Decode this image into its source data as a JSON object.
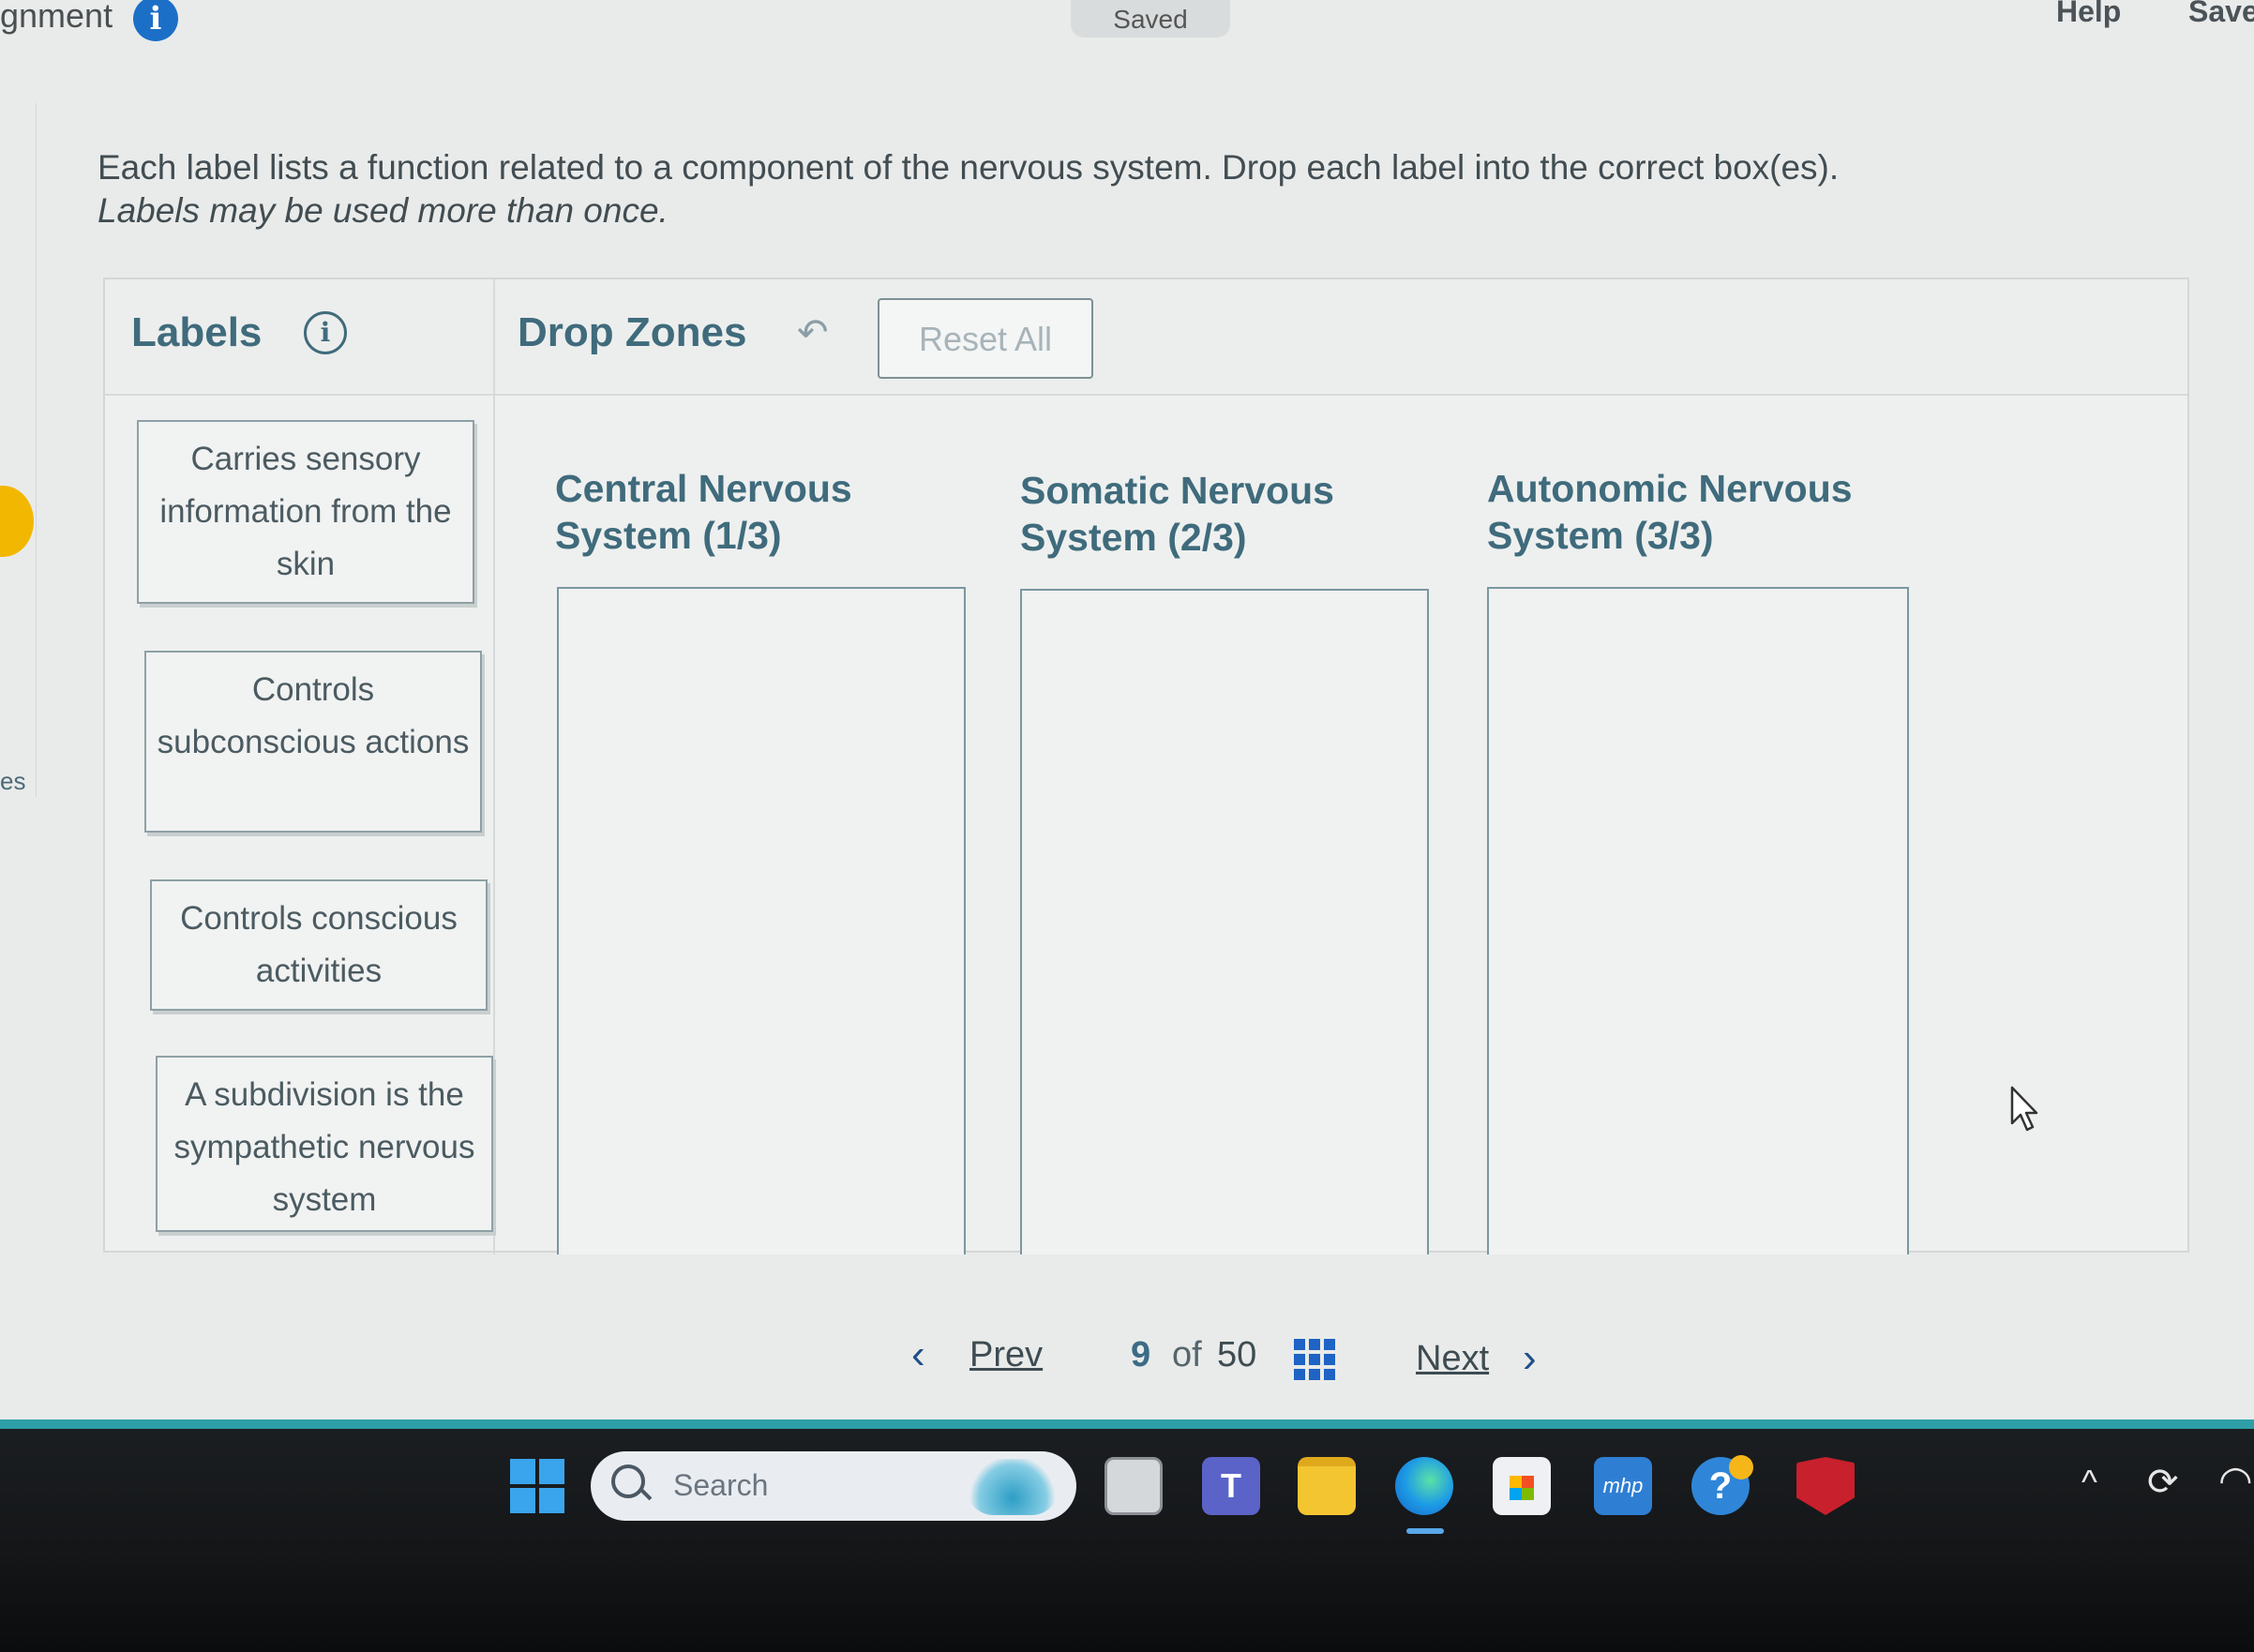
{
  "topbar": {
    "assignment_title_fragment": "gnment",
    "info_glyph": "i",
    "saved_status": "Saved",
    "help_label": "Help",
    "save_label": "Save"
  },
  "side": {
    "tab_fragment": "es"
  },
  "instructions": {
    "line1": "Each label lists a function related to a component of the nervous system. Drop each label into the correct box(es).",
    "line2": "Labels may be used more than once."
  },
  "labels_panel": {
    "title": "Labels",
    "info_glyph": "i",
    "items": [
      "Carries sensory information from the skin",
      "Controls subconscious actions",
      "Controls conscious activities",
      "A subdivision is the sympathetic nervous system"
    ]
  },
  "drop_zones": {
    "title": "Drop Zones",
    "undo_glyph": "↶",
    "reset_label": "Reset All",
    "zones": [
      {
        "title": "Central Nervous System (1/3)"
      },
      {
        "title": "Somatic Nervous System (2/3)"
      },
      {
        "title": "Autonomic Nervous System (3/3)"
      }
    ]
  },
  "pagination": {
    "prev_label": "Prev",
    "current": "9",
    "of_label": "of",
    "total": "50",
    "next_label": "Next",
    "prev_glyph": "‹",
    "next_glyph": "›"
  },
  "taskbar": {
    "search_placeholder": "Search",
    "teams_glyph": "T",
    "mhp_glyph": "mhp",
    "help_glyph": "?",
    "tray_caret": "^",
    "tray_sync": "⟳",
    "tray_wifi": "◠",
    "icons": [
      "start-icon",
      "search-icon",
      "task-view-icon",
      "teams-icon",
      "file-explorer-icon",
      "edge-icon",
      "store-icon",
      "mhp-icon",
      "get-help-icon",
      "mcafee-icon",
      "tray-caret-icon",
      "sync-icon",
      "wifi-icon"
    ]
  },
  "colors": {
    "heading": "#3f6b7c",
    "accent_blue": "#1c6fc7",
    "taskbar_line": "#2e9fa6"
  }
}
